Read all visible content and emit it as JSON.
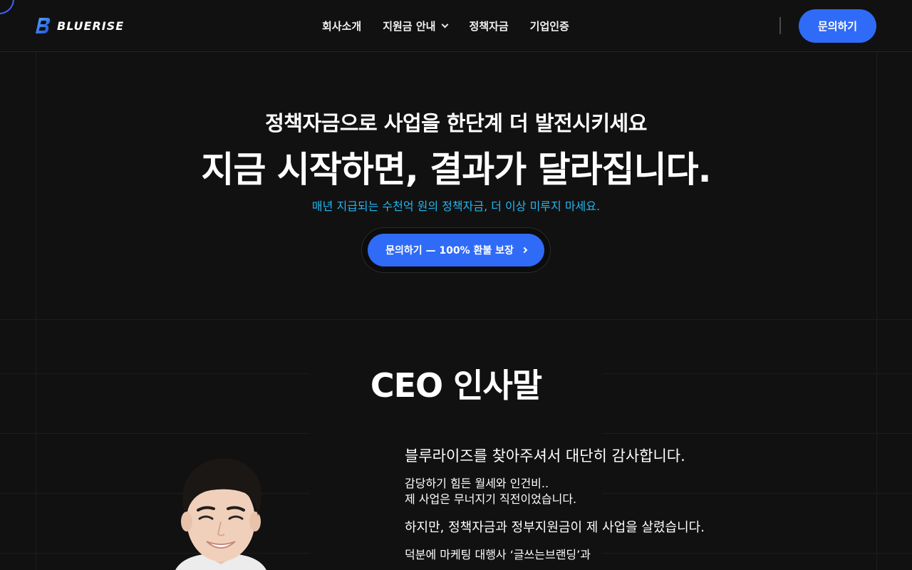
{
  "header": {
    "brand": "BLUERISE",
    "nav": [
      {
        "label": "회사소개"
      },
      {
        "label": "지원금 안내"
      },
      {
        "label": "정책자금"
      },
      {
        "label": "기업인증"
      }
    ],
    "cta_label": "문의하기"
  },
  "hero": {
    "subtitle": "정책자금으로 사업을 한단계 더 발전시키세요",
    "title": "지금 시작하면, 결과가 달라집니다.",
    "note": "매년 지급되는 수천억 원의 정책자금, 더 이상 미루지 마세요.",
    "cta_label": "문의하기 — 100% 환불 보장"
  },
  "ceo": {
    "heading": "CEO 인사말",
    "lead": "블루라이즈를 찾아주셔서 대단히 감사합니다.",
    "body_line1": "감당하기 힘든 월세와 인건비..",
    "body_line2": "제 사업은 무너지기 직전이었습니다.",
    "emphasis": "하지만, 정책자금과 정부지원금이 제 사업을 살렸습니다.",
    "body_line3": "덕분에 마케팅 대행사 ‘글쓰는브랜딩’과"
  },
  "colors": {
    "background": "#111111",
    "accent": "#2f6bf7",
    "highlight": "#22b7f2"
  },
  "icons": {
    "logo": "bluerise-logo-icon",
    "dropdown": "chevron-down-icon",
    "cta_arrow": "chevron-right-icon"
  }
}
